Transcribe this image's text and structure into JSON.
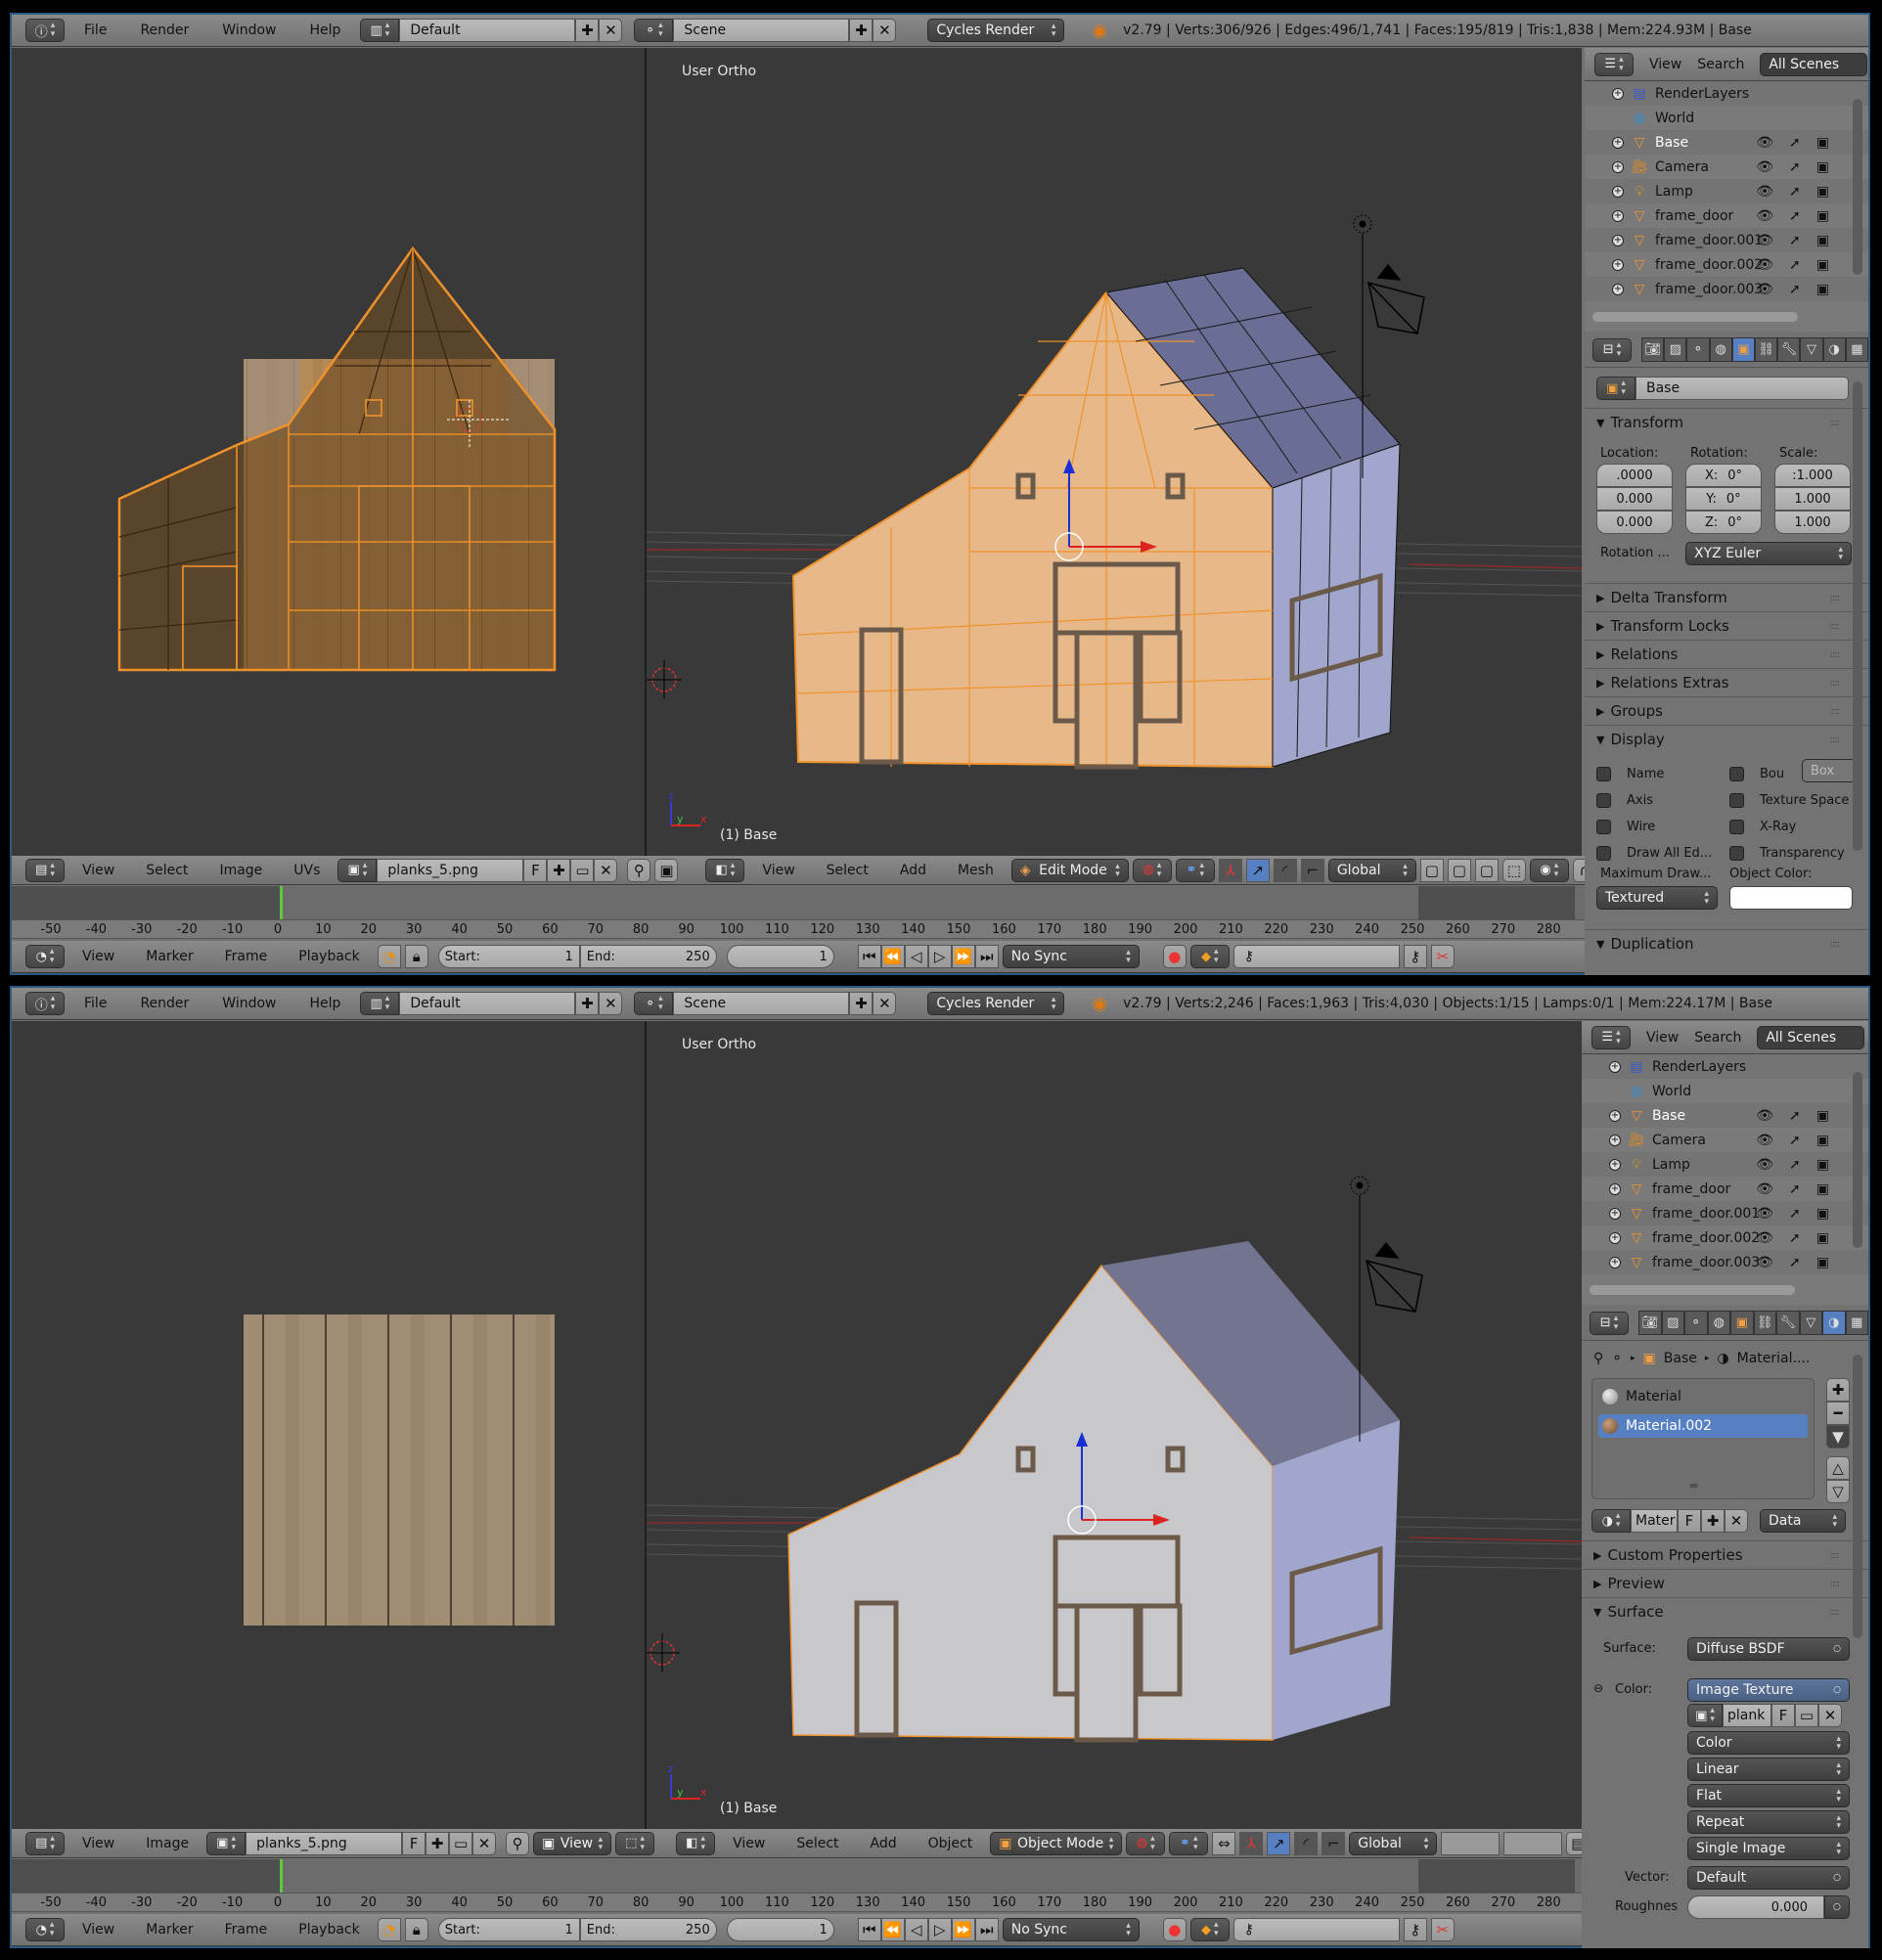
{
  "top": {
    "info_header": {
      "menus": [
        "File",
        "Render",
        "Window",
        "Help"
      ],
      "screen_layout": "Default",
      "scene": "Scene",
      "render_engine": "Cycles Render",
      "stats": "v2.79 | Verts:306/926 | Edges:496/1,741 | Faces:195/819 | Tris:1,838 | Mem:224.93M | Base"
    },
    "image_editor": {
      "menus": [
        "View",
        "Select",
        "Image",
        "UVs"
      ],
      "image_name": "planks_5.png",
      "fake_user": "F"
    },
    "viewport": {
      "label": "User Ortho",
      "object_label": "(1) Base",
      "menus": [
        "View",
        "Select",
        "Add",
        "Mesh"
      ],
      "mode": "Edit Mode",
      "orientation": "Global"
    },
    "outliner": {
      "menus": [
        "View",
        "Search"
      ],
      "filter": "All Scenes",
      "items": [
        {
          "name": "RenderLayers",
          "icon": "render-layers-icon",
          "restrict": false
        },
        {
          "name": "World",
          "icon": "world-icon",
          "restrict": false
        },
        {
          "name": "Base",
          "icon": "mesh-icon",
          "restrict": true,
          "selected": true
        },
        {
          "name": "Camera",
          "icon": "camera-icon",
          "restrict": true
        },
        {
          "name": "Lamp",
          "icon": "lamp-icon",
          "restrict": true
        },
        {
          "name": "frame_door",
          "icon": "mesh-icon",
          "restrict": true
        },
        {
          "name": "frame_door.001",
          "icon": "mesh-icon",
          "restrict": true
        },
        {
          "name": "frame_door.002",
          "icon": "mesh-icon",
          "restrict": true
        },
        {
          "name": "frame_door.003",
          "icon": "mesh-icon",
          "restrict": true
        }
      ]
    },
    "properties": {
      "object_name": "Base",
      "transform": {
        "title": "Transform",
        "location_label": "Location:",
        "rotation_label": "Rotation:",
        "scale_label": "Scale:",
        "location": [
          ".0000",
          "0.000",
          "0.000"
        ],
        "rotation": [
          {
            "axis": "X:",
            "value": "0°"
          },
          {
            "axis": "Y:",
            "value": "0°"
          },
          {
            "axis": "Z:",
            "value": "0°"
          }
        ],
        "scale": [
          ":1.000",
          "1.000",
          "1.000"
        ],
        "rotation_mode_label": "Rotation ...",
        "rotation_mode": "XYZ Euler"
      },
      "collapsed_panels": [
        "Delta Transform",
        "Transform Locks",
        "Relations",
        "Relations Extras",
        "Groups"
      ],
      "display": {
        "title": "Display",
        "left_checks": [
          "Name",
          "Axis",
          "Wire",
          "Draw All Ed..."
        ],
        "right_checks": [
          "Bou",
          "Texture Space",
          "X-Ray",
          "Transparency"
        ],
        "bounds_type": "Box",
        "max_draw_label": "Maximum Draw...",
        "max_draw": "Textured",
        "object_color_label": "Object Color:",
        "object_color": "#ffffff"
      },
      "duplication": "Duplication"
    },
    "timeline": {
      "menus": [
        "View",
        "Marker",
        "Frame",
        "Playback"
      ],
      "start_label": "Start:",
      "start": "1",
      "end_label": "End:",
      "end": "250",
      "current": "1",
      "sync": "No Sync",
      "ticks": [
        "-50",
        "-40",
        "-30",
        "-20",
        "-10",
        "0",
        "10",
        "20",
        "30",
        "40",
        "50",
        "60",
        "70",
        "80",
        "90",
        "100",
        "110",
        "120",
        "130",
        "140",
        "150",
        "160",
        "170",
        "180",
        "190",
        "200",
        "210",
        "220",
        "230",
        "240",
        "250",
        "260",
        "270",
        "280"
      ]
    }
  },
  "bottom": {
    "info_header": {
      "menus": [
        "File",
        "Render",
        "Window",
        "Help"
      ],
      "screen_layout": "Default",
      "scene": "Scene",
      "render_engine": "Cycles Render",
      "stats": "v2.79 | Verts:2,246 | Faces:1,963 | Tris:4,030 | Objects:1/15 | Lamps:0/1 | Mem:224.17M | Base"
    },
    "image_editor": {
      "menus": [
        "View",
        "Image"
      ],
      "image_name": "planks_5.png",
      "fake_user": "F",
      "view_mode": "View"
    },
    "viewport": {
      "label": "User Ortho",
      "object_label": "(1) Base",
      "menus": [
        "View",
        "Select",
        "Add",
        "Object"
      ],
      "mode": "Object Mode",
      "orientation": "Global"
    },
    "outliner": {
      "menus": [
        "View",
        "Search"
      ],
      "filter": "All Scenes",
      "items": [
        {
          "name": "RenderLayers",
          "icon": "render-layers-icon",
          "restrict": false
        },
        {
          "name": "World",
          "icon": "world-icon",
          "restrict": false
        },
        {
          "name": "Base",
          "icon": "mesh-icon",
          "restrict": true,
          "selected": true
        },
        {
          "name": "Camera",
          "icon": "camera-icon",
          "restrict": true
        },
        {
          "name": "Lamp",
          "icon": "lamp-icon",
          "restrict": true
        },
        {
          "name": "frame_door",
          "icon": "mesh-icon",
          "restrict": true
        },
        {
          "name": "frame_door.001",
          "icon": "mesh-icon",
          "restrict": true
        },
        {
          "name": "frame_door.002",
          "icon": "mesh-icon",
          "restrict": true
        },
        {
          "name": "frame_door.003",
          "icon": "mesh-icon",
          "restrict": true
        }
      ]
    },
    "properties": {
      "breadcrumb": [
        "Base",
        "Material...."
      ],
      "materials": [
        "Material",
        "Material.002"
      ],
      "active_material_index": 1,
      "material_field": "Mater",
      "fake_user": "F",
      "link": "Data",
      "collapsed_panels": [
        "Custom Properties",
        "Preview"
      ],
      "surface": {
        "title": "Surface",
        "surface_label": "Surface:",
        "surface_value": "Diffuse BSDF",
        "color_label": "Color:",
        "color_value": "Image Texture",
        "image_field": "plank",
        "fake_user": "F",
        "options": [
          "Color",
          "Linear",
          "Flat",
          "Repeat",
          "Single Image"
        ],
        "vector_label": "Vector:",
        "vector_value": "Default",
        "roughness_label": "Roughnes",
        "roughness_value": "0.000"
      }
    },
    "timeline": {
      "menus": [
        "View",
        "Marker",
        "Frame",
        "Playback"
      ],
      "start_label": "Start:",
      "start": "1",
      "end_label": "End:",
      "end": "250",
      "current": "1",
      "sync": "No Sync",
      "ticks": [
        "-50",
        "-40",
        "-30",
        "-20",
        "-10",
        "0",
        "10",
        "20",
        "30",
        "40",
        "50",
        "60",
        "70",
        "80",
        "90",
        "100",
        "110",
        "120",
        "130",
        "140",
        "150",
        "160",
        "170",
        "180",
        "190",
        "200",
        "210",
        "220",
        "230",
        "240",
        "250",
        "260",
        "270",
        "280"
      ]
    }
  },
  "colors": {
    "selection_orange": "#f0922b",
    "active_blue": "#5680c2",
    "viewport_bg": "#393939",
    "frame_green": "#5ec83c"
  }
}
